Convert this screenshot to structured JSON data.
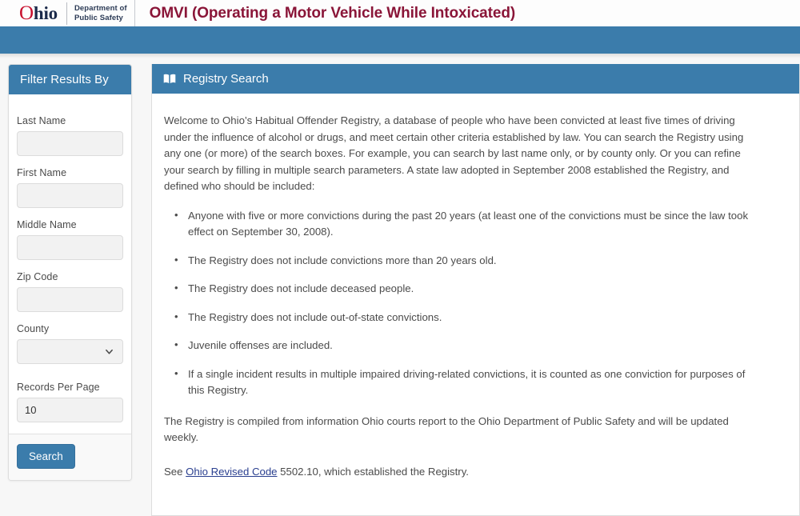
{
  "header": {
    "logo": {
      "o_letter": "O",
      "rest": "hio",
      "dept_line1": "Department of",
      "dept_line2": "Public Safety"
    },
    "title": "OMVI (Operating a Motor Vehicle While Intoxicated)",
    "title_color": "#8a1538",
    "band_color": "#3b7cab",
    "accent_red": "#cf1b32"
  },
  "sidebar": {
    "heading": "Filter Results By",
    "fields": [
      {
        "label": "Last Name",
        "value": "",
        "placeholder": "",
        "type": "text",
        "name": "last-name"
      },
      {
        "label": "First Name",
        "value": "",
        "placeholder": "",
        "type": "text",
        "name": "first-name"
      },
      {
        "label": "Middle Name",
        "value": "",
        "placeholder": "",
        "type": "text",
        "name": "middle-name"
      },
      {
        "label": "Zip Code",
        "value": "",
        "placeholder": "",
        "type": "text",
        "name": "zip-code"
      }
    ],
    "county": {
      "label": "County",
      "value": "",
      "options": [
        ""
      ]
    },
    "records_per_page": {
      "label": "Records Per Page",
      "value": "10"
    },
    "search_button": "Search"
  },
  "main": {
    "heading": "Registry Search",
    "heading_icon": "open-book-icon",
    "intro": "Welcome to Ohio’s Habitual Offender Registry, a database of people who have been convicted at least five times of driving under the influence of alcohol or drugs, and meet certain other criteria established by law. You can search the Registry using any one (or more) of the search boxes. For example, you can search by last name only, or by county only. Or you can refine your search by filling in multiple search parameters. A state law adopted in September 2008 established the Registry, and defined who should be included:",
    "rules": [
      "Anyone with five or more convictions during the past 20 years (at least one of the convictions must be since the law took effect on September 30, 2008).",
      "The Registry does not include convictions more than 20 years old.",
      "The Registry does not include deceased people.",
      "The Registry does not include out-of-state convictions.",
      "Juvenile offenses are included.",
      "If a single incident results in multiple impaired driving-related convictions, it is counted as one conviction for purposes of this Registry."
    ],
    "compiled_note": "The Registry is compiled from information Ohio courts report to the Ohio Department of Public Safety and will be updated weekly.",
    "see_prefix": "See ",
    "see_link": "Ohio Revised Code",
    "see_suffix": " 5502.10, which established the Registry."
  }
}
